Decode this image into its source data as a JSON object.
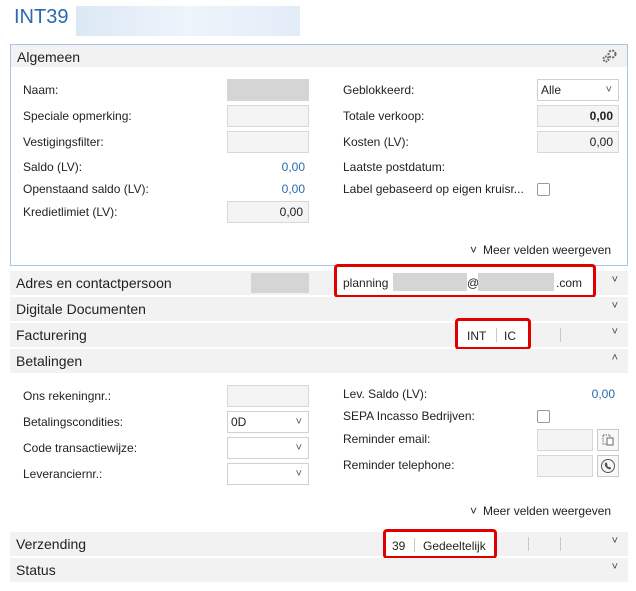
{
  "header": {
    "title": "INT39 ·"
  },
  "algemeen": {
    "title": "Algemeen",
    "left": [
      {
        "label": "Naam:",
        "value": ""
      },
      {
        "label": "Speciale opmerking:",
        "value": ""
      },
      {
        "label": "Vestigingsfilter:",
        "value": ""
      },
      {
        "label": "Saldo (LV):",
        "value": "0,00"
      },
      {
        "label": "Openstaand saldo (LV):",
        "value": "0,00"
      },
      {
        "label": "Kredietlimiet (LV):",
        "value": "0,00"
      }
    ],
    "right": [
      {
        "label": "Geblokkeerd:",
        "value": "Alle"
      },
      {
        "label": "Totale verkoop:",
        "value": "0,00"
      },
      {
        "label": "Kosten (LV):",
        "value": "0,00"
      },
      {
        "label": "Laatste postdatum:",
        "value": ""
      },
      {
        "label": "Label gebaseerd op eigen kruisr...",
        "value": ""
      }
    ],
    "more": "Meer velden weergeven"
  },
  "adres": {
    "title": "Adres en contactpersoon",
    "email_prefix": "planning",
    "email_at": "@",
    "email_suffix": ".com"
  },
  "digitale": {
    "title": "Digitale Documenten"
  },
  "facturering": {
    "title": "Facturering",
    "tag1": "INT",
    "tag2": "IC"
  },
  "betalingen": {
    "title": "Betalingen",
    "left": [
      {
        "label": "Ons rekeningnr.:",
        "value": ""
      },
      {
        "label": "Betalingscondities:",
        "value": "0D"
      },
      {
        "label": "Code transactiewijze:",
        "value": ""
      },
      {
        "label": "Leveranciernr.:",
        "value": ""
      }
    ],
    "right": [
      {
        "label": "Lev. Saldo (LV):",
        "value": "0,00"
      },
      {
        "label": "SEPA Incasso Bedrijven:",
        "value": ""
      },
      {
        "label": "Reminder email:",
        "value": ""
      },
      {
        "label": "Reminder telephone:",
        "value": ""
      }
    ],
    "more": "Meer velden weergeven"
  },
  "verzending": {
    "title": "Verzending",
    "tag1": "39",
    "tag2": "Gedeeltelijk"
  },
  "status": {
    "title": "Status"
  },
  "icons": {
    "chevron_down": "˅",
    "chevron_up": "˄",
    "gear": "gear-icon"
  }
}
